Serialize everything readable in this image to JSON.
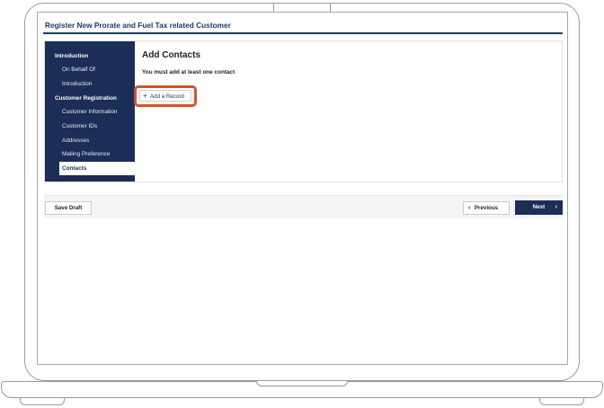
{
  "header": {
    "title": "Register New Prorate and Fuel Tax related Customer"
  },
  "sidebar": {
    "items": [
      {
        "label": "Introduction",
        "type": "section"
      },
      {
        "label": "On Behalf Of",
        "type": "sub"
      },
      {
        "label": "Introduction",
        "type": "sub"
      },
      {
        "label": "Customer Registration",
        "type": "section"
      },
      {
        "label": "Customer Information",
        "type": "sub"
      },
      {
        "label": "Customer IDs",
        "type": "sub"
      },
      {
        "label": "Addresses",
        "type": "sub"
      },
      {
        "label": "Mailing Preference",
        "type": "sub"
      },
      {
        "label": "Contacts",
        "type": "active"
      }
    ]
  },
  "main": {
    "heading": "Add Contacts",
    "message": "You must add at least one contact",
    "add_record_label": "Add a Record",
    "add_record_icon": "+"
  },
  "footer": {
    "save_draft_label": "Save Draft",
    "previous_label": "Previous",
    "next_label": "Next",
    "prev_icon": "‹",
    "next_icon": "›"
  },
  "colors": {
    "brand_navy": "#1a2e57",
    "highlight_orange": "#d1542a"
  }
}
